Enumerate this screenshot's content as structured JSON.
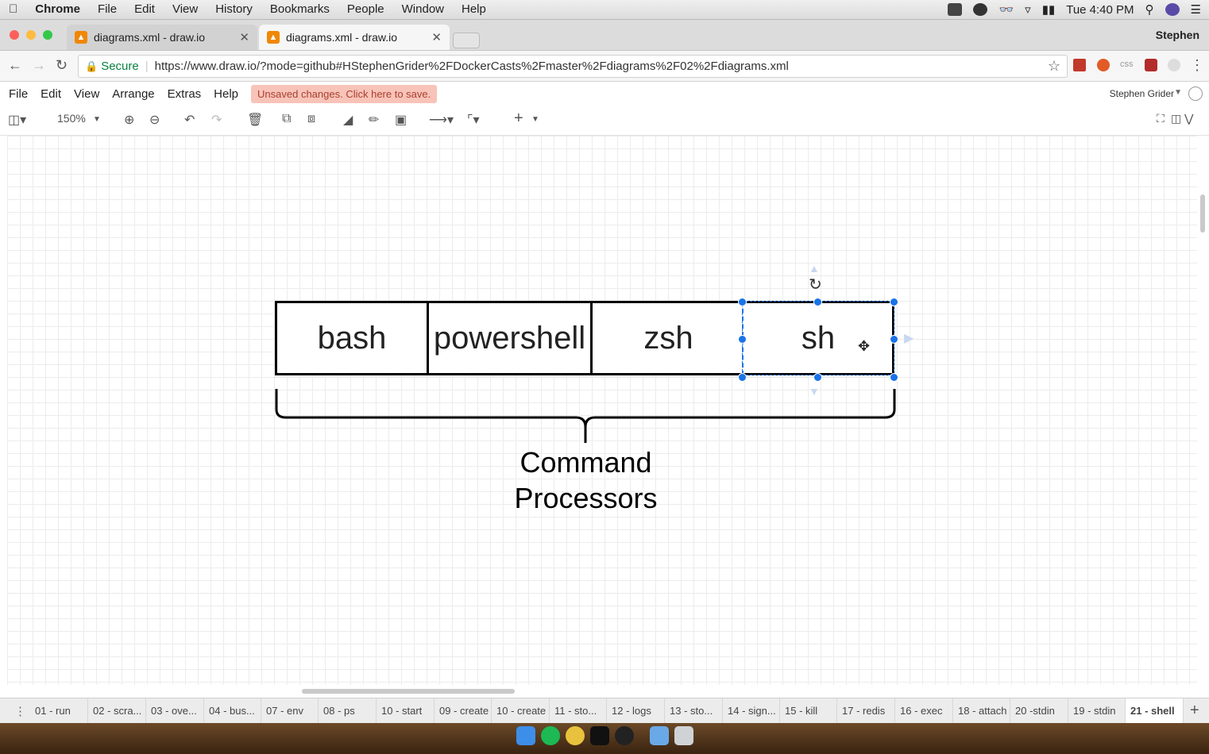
{
  "menubar": {
    "app": "Chrome",
    "items": [
      "File",
      "Edit",
      "View",
      "History",
      "Bookmarks",
      "People",
      "Window",
      "Help"
    ],
    "clock": "Tue 4:40 PM"
  },
  "browser": {
    "tabs": [
      {
        "title": "diagrams.xml - draw.io"
      },
      {
        "title": "diagrams.xml - draw.io"
      }
    ],
    "profile": "Stephen",
    "secure_label": "Secure",
    "url": "https://www.draw.io/?mode=github#HStephenGrider%2FDockerCasts%2Fmaster%2Fdiagrams%2F02%2Fdiagrams.xml"
  },
  "drawio": {
    "menu": [
      "File",
      "Edit",
      "View",
      "Arrange",
      "Extras",
      "Help"
    ],
    "unsaved": "Unsaved changes. Click here to save.",
    "user": "Stephen Grider",
    "zoom": "150%"
  },
  "diagram": {
    "cells": [
      "bash",
      "powershell",
      "zsh",
      "sh"
    ],
    "label_line1": "Command",
    "label_line2": "Processors"
  },
  "pages": [
    "01 - run",
    "02 - scra...",
    "03 - ove...",
    "04 - bus...",
    "07 - env",
    "08 - ps",
    "10 - start",
    "09 - create",
    "10 - create",
    "11 - sto...",
    "12 - logs",
    "13 - sto...",
    "14 - sign...",
    "15 - kill",
    "17 - redis",
    "16 - exec",
    "18 - attach",
    "20 -stdin",
    "19 - stdin",
    "21 - shell"
  ],
  "colors": {
    "accent": "#1a73e8",
    "unsaved_bg": "#f8c3b8",
    "drawio_orange": "#f08705"
  }
}
